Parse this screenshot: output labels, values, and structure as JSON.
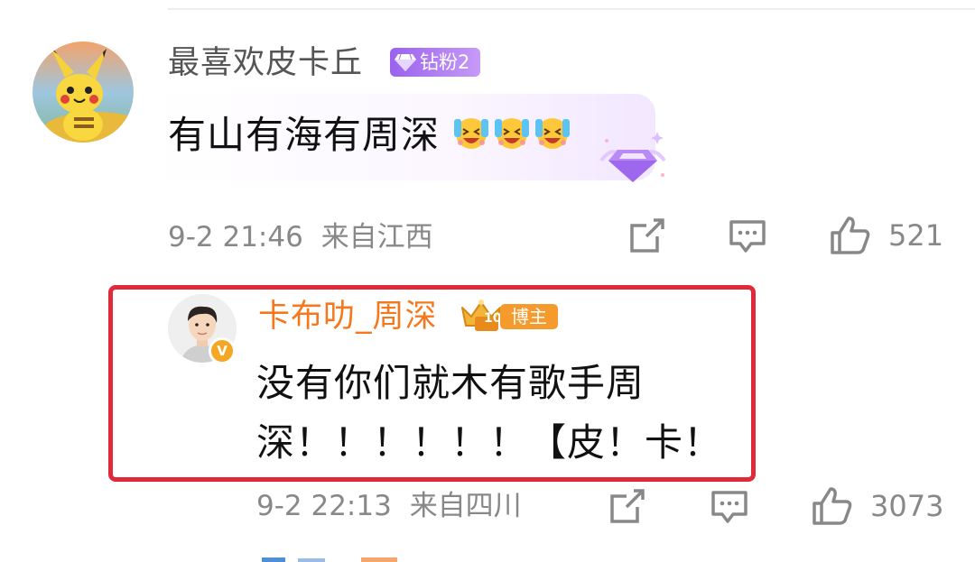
{
  "comment": {
    "username": "最喜欢皮卡丘",
    "fan_badge": "钻粉2",
    "text": "有山有海有周深",
    "emoji": [
      "laughing-tears-emoji",
      "laughing-tears-emoji",
      "laughing-tears-emoji"
    ],
    "time": "9-2 21:46",
    "location": "来自江西",
    "likes": "521"
  },
  "reply": {
    "username": "卡布叻_周深",
    "level": "10",
    "role_tag": "博主",
    "verified_mark": "V",
    "text": "没有你们就木有歌手周深！！！！！！【皮！卡！",
    "time": "9-2 22:13",
    "location": "来自四川",
    "likes": "3073"
  },
  "colors": {
    "highlight_border": "#e02a3a",
    "reply_name": "#f5781e",
    "fan_badge": "#9a62ee",
    "meta_text": "#888888"
  },
  "icons": [
    "share-icon",
    "comment-icon",
    "like-icon",
    "diamond-icon",
    "crown-icon",
    "verified-icon"
  ]
}
